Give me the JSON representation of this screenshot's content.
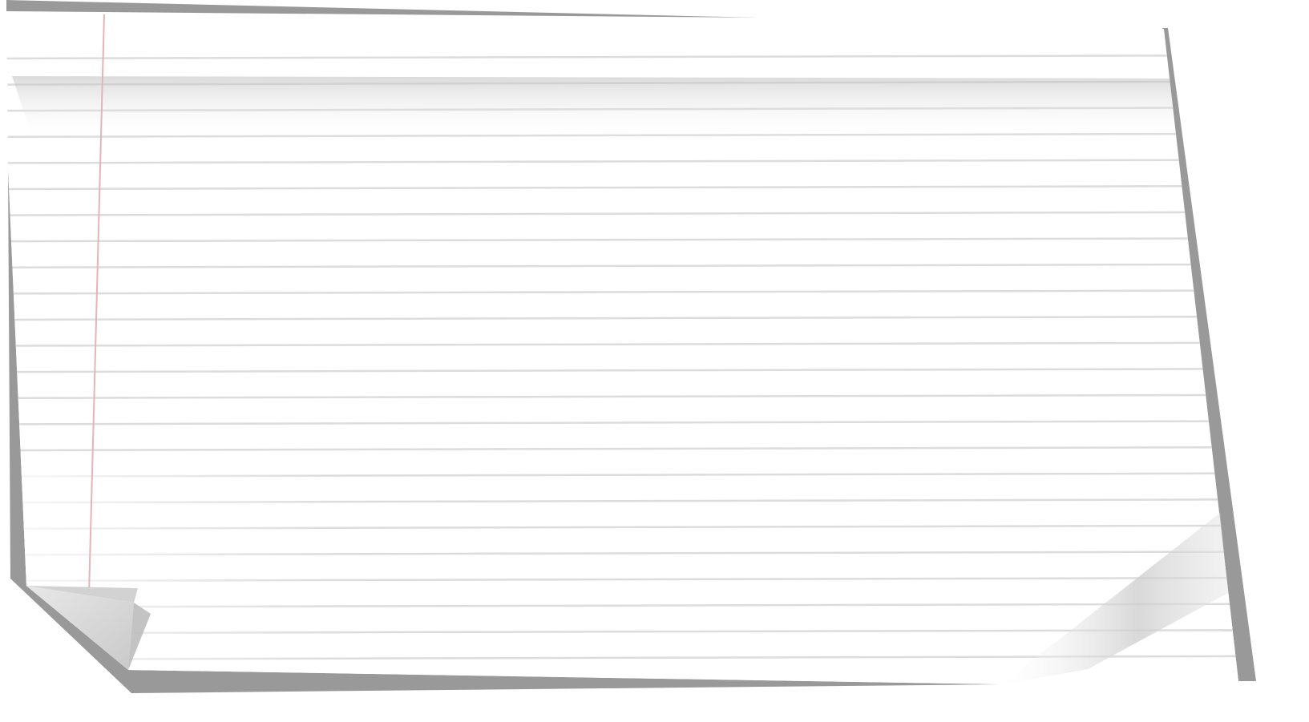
{
  "colors": {
    "background": "#ffffff",
    "paper": "#ffffff",
    "shadow": "#999999",
    "rule_line": "#dcdcdc",
    "margin_line": "#e3b4b8",
    "fold_shade": "#cfcfcf"
  },
  "icons": {
    "paper": "lined-notebook-paper-icon",
    "curled_corner_left": "curled-corner-icon",
    "curled_corner_right": "page-curl-shadow-icon"
  },
  "content": {
    "texts": []
  }
}
